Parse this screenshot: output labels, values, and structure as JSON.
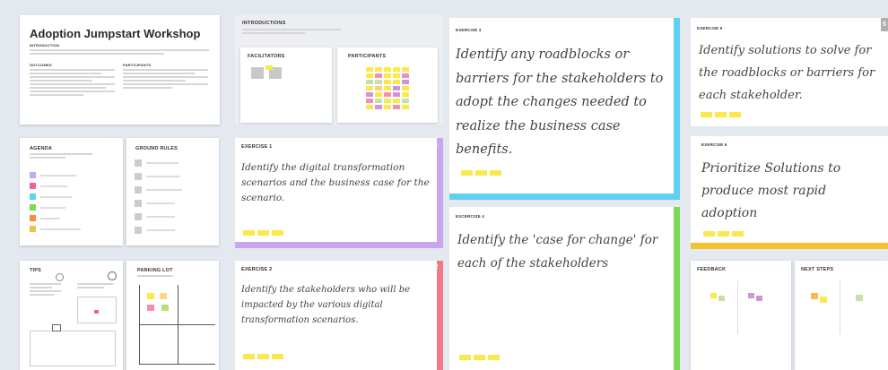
{
  "workshop": {
    "title": "Adoption Jumpstart Workshop",
    "intro_label": "INTRODUCTION",
    "outcomes_label": "OUTCOMES",
    "participants_label": "PARTICIPANTS"
  },
  "introductions": {
    "title": "INTRODUCTIONS",
    "facilitators": "FACILITATORS",
    "participants": "PARTICIPANTS"
  },
  "agenda": {
    "title": "AGENDA",
    "colors": [
      "#c9a6f0",
      "#f06292",
      "#7ed957",
      "#f0c04a",
      "#ff8a3d",
      "#66c2e8"
    ]
  },
  "ground_rules": {
    "title": "GROUND RULES"
  },
  "tips": {
    "title": "TIPS"
  },
  "parking_lot": {
    "title": "PARKING LOT"
  },
  "exercises": [
    {
      "label": "EXERCISE 1",
      "num": "1",
      "color": "#c9a6f0",
      "text": "Identify the digital transformation scenarios and the business case for the scenario."
    },
    {
      "label": "EXERCISE 2",
      "num": "2",
      "color": "#f27a86",
      "text": "Identify the stakeholders who will be impacted by the various digital transformation scenarios."
    },
    {
      "label": "EXERCISE 3",
      "num": "3",
      "color": "#5ed0f2",
      "text": "Identify any roadblocks or barriers for the stakeholders to adopt the changes needed to realize the business case benefits."
    },
    {
      "label": "EXCERCISE 4",
      "num": "4",
      "color": "#7ed957",
      "text": "Identify the 'case for change' for each of the stakeholders"
    },
    {
      "label": "EXERCISE 5",
      "num": "5",
      "color": "#b0b0b0",
      "text": "Identify solutions to solve for the roadblocks or barriers for each stakeholder."
    },
    {
      "label": "EXERCISE 6",
      "num": "6",
      "color": "#f2c230",
      "text": "Prioritize Solutions to produce most rapid adoption"
    }
  ],
  "feedback": {
    "title": "FEEDBACK"
  },
  "next_steps": {
    "title": "NEXT STEPS"
  }
}
